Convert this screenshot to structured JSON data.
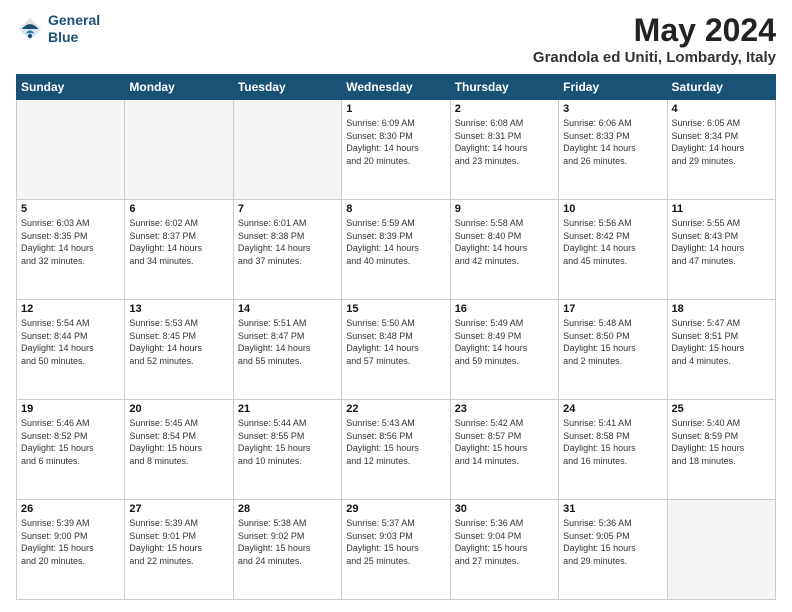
{
  "header": {
    "logo_line1": "General",
    "logo_line2": "Blue",
    "month": "May 2024",
    "location": "Grandola ed Uniti, Lombardy, Italy"
  },
  "days_of_week": [
    "Sunday",
    "Monday",
    "Tuesday",
    "Wednesday",
    "Thursday",
    "Friday",
    "Saturday"
  ],
  "weeks": [
    [
      {
        "day": "",
        "info": ""
      },
      {
        "day": "",
        "info": ""
      },
      {
        "day": "",
        "info": ""
      },
      {
        "day": "1",
        "info": "Sunrise: 6:09 AM\nSunset: 8:30 PM\nDaylight: 14 hours\nand 20 minutes."
      },
      {
        "day": "2",
        "info": "Sunrise: 6:08 AM\nSunset: 8:31 PM\nDaylight: 14 hours\nand 23 minutes."
      },
      {
        "day": "3",
        "info": "Sunrise: 6:06 AM\nSunset: 8:33 PM\nDaylight: 14 hours\nand 26 minutes."
      },
      {
        "day": "4",
        "info": "Sunrise: 6:05 AM\nSunset: 8:34 PM\nDaylight: 14 hours\nand 29 minutes."
      }
    ],
    [
      {
        "day": "5",
        "info": "Sunrise: 6:03 AM\nSunset: 8:35 PM\nDaylight: 14 hours\nand 32 minutes."
      },
      {
        "day": "6",
        "info": "Sunrise: 6:02 AM\nSunset: 8:37 PM\nDaylight: 14 hours\nand 34 minutes."
      },
      {
        "day": "7",
        "info": "Sunrise: 6:01 AM\nSunset: 8:38 PM\nDaylight: 14 hours\nand 37 minutes."
      },
      {
        "day": "8",
        "info": "Sunrise: 5:59 AM\nSunset: 8:39 PM\nDaylight: 14 hours\nand 40 minutes."
      },
      {
        "day": "9",
        "info": "Sunrise: 5:58 AM\nSunset: 8:40 PM\nDaylight: 14 hours\nand 42 minutes."
      },
      {
        "day": "10",
        "info": "Sunrise: 5:56 AM\nSunset: 8:42 PM\nDaylight: 14 hours\nand 45 minutes."
      },
      {
        "day": "11",
        "info": "Sunrise: 5:55 AM\nSunset: 8:43 PM\nDaylight: 14 hours\nand 47 minutes."
      }
    ],
    [
      {
        "day": "12",
        "info": "Sunrise: 5:54 AM\nSunset: 8:44 PM\nDaylight: 14 hours\nand 50 minutes."
      },
      {
        "day": "13",
        "info": "Sunrise: 5:53 AM\nSunset: 8:45 PM\nDaylight: 14 hours\nand 52 minutes."
      },
      {
        "day": "14",
        "info": "Sunrise: 5:51 AM\nSunset: 8:47 PM\nDaylight: 14 hours\nand 55 minutes."
      },
      {
        "day": "15",
        "info": "Sunrise: 5:50 AM\nSunset: 8:48 PM\nDaylight: 14 hours\nand 57 minutes."
      },
      {
        "day": "16",
        "info": "Sunrise: 5:49 AM\nSunset: 8:49 PM\nDaylight: 14 hours\nand 59 minutes."
      },
      {
        "day": "17",
        "info": "Sunrise: 5:48 AM\nSunset: 8:50 PM\nDaylight: 15 hours\nand 2 minutes."
      },
      {
        "day": "18",
        "info": "Sunrise: 5:47 AM\nSunset: 8:51 PM\nDaylight: 15 hours\nand 4 minutes."
      }
    ],
    [
      {
        "day": "19",
        "info": "Sunrise: 5:46 AM\nSunset: 8:52 PM\nDaylight: 15 hours\nand 6 minutes."
      },
      {
        "day": "20",
        "info": "Sunrise: 5:45 AM\nSunset: 8:54 PM\nDaylight: 15 hours\nand 8 minutes."
      },
      {
        "day": "21",
        "info": "Sunrise: 5:44 AM\nSunset: 8:55 PM\nDaylight: 15 hours\nand 10 minutes."
      },
      {
        "day": "22",
        "info": "Sunrise: 5:43 AM\nSunset: 8:56 PM\nDaylight: 15 hours\nand 12 minutes."
      },
      {
        "day": "23",
        "info": "Sunrise: 5:42 AM\nSunset: 8:57 PM\nDaylight: 15 hours\nand 14 minutes."
      },
      {
        "day": "24",
        "info": "Sunrise: 5:41 AM\nSunset: 8:58 PM\nDaylight: 15 hours\nand 16 minutes."
      },
      {
        "day": "25",
        "info": "Sunrise: 5:40 AM\nSunset: 8:59 PM\nDaylight: 15 hours\nand 18 minutes."
      }
    ],
    [
      {
        "day": "26",
        "info": "Sunrise: 5:39 AM\nSunset: 9:00 PM\nDaylight: 15 hours\nand 20 minutes."
      },
      {
        "day": "27",
        "info": "Sunrise: 5:39 AM\nSunset: 9:01 PM\nDaylight: 15 hours\nand 22 minutes."
      },
      {
        "day": "28",
        "info": "Sunrise: 5:38 AM\nSunset: 9:02 PM\nDaylight: 15 hours\nand 24 minutes."
      },
      {
        "day": "29",
        "info": "Sunrise: 5:37 AM\nSunset: 9:03 PM\nDaylight: 15 hours\nand 25 minutes."
      },
      {
        "day": "30",
        "info": "Sunrise: 5:36 AM\nSunset: 9:04 PM\nDaylight: 15 hours\nand 27 minutes."
      },
      {
        "day": "31",
        "info": "Sunrise: 5:36 AM\nSunset: 9:05 PM\nDaylight: 15 hours\nand 29 minutes."
      },
      {
        "day": "",
        "info": ""
      }
    ]
  ]
}
